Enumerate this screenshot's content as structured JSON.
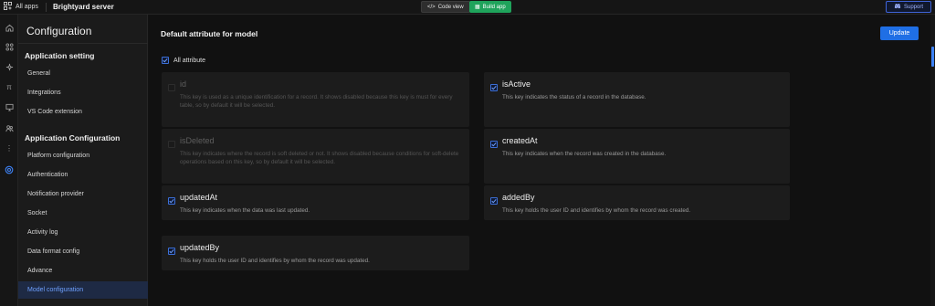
{
  "topbar": {
    "all_apps": "All apps",
    "server_name": "Brightyard server",
    "code_view": "Code view",
    "build_app": "Build app",
    "support": "Support"
  },
  "sidebar": {
    "title": "Configuration",
    "sections": [
      {
        "heading": "Application setting",
        "items": [
          "General",
          "Integrations",
          "VS Code extension"
        ]
      },
      {
        "heading": "Application Configuration",
        "items": [
          "Platform configuration",
          "Authentication",
          "Notification provider",
          "Socket",
          "Activity log",
          "Data format config",
          "Advance",
          "Model configuration"
        ]
      }
    ],
    "active_item": "Model configuration"
  },
  "main": {
    "heading": "Default attribute for model",
    "update_label": "Update",
    "all_attribute_label": "All attribute",
    "attributes": [
      {
        "name": "id",
        "desc": "This key is used as a unique identification for a record. It shows disabled because this key is must for every table, so by default it will be selected.",
        "checked": false,
        "disabled": true
      },
      {
        "name": "isActive",
        "desc": "This key indicates the status of a record in the database.",
        "checked": true,
        "disabled": false
      },
      {
        "name": "isDeleted",
        "desc": "This key indicates where the record is soft deleted or not. It shows disabled because conditions for soft-delete operations based on this key, so by default it will be selected.",
        "checked": false,
        "disabled": true
      },
      {
        "name": "createdAt",
        "desc": "This key indicates when the record was created in the database.",
        "checked": true,
        "disabled": false
      },
      {
        "name": "updatedAt",
        "desc": "This key indicates when the data was last updated.",
        "checked": true,
        "disabled": false
      },
      {
        "name": "addedBy",
        "desc": "This key holds the user ID and identifies by whom the record was created.",
        "checked": true,
        "disabled": false
      },
      {
        "name": "updatedBy",
        "desc": "This key holds the user ID and identifies by whom the record was updated.",
        "checked": true,
        "disabled": false
      }
    ]
  },
  "colors": {
    "accent": "#1f6fe5",
    "build": "#1fa35b",
    "active_bg": "#1e2a44"
  }
}
